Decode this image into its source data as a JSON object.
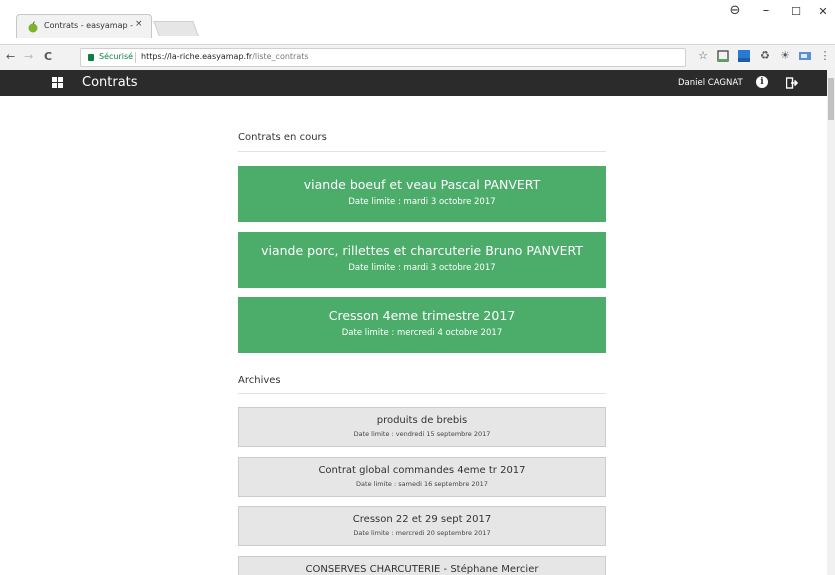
{
  "browser": {
    "tab_title": "Contrats - easyamap -",
    "tab_close": "×",
    "secure_label": "Sécurisé",
    "url_host": "https://la-riche.easyamap.fr",
    "url_path": "/liste_contrats",
    "window_controls": {
      "account": "⊖",
      "minimize": "–",
      "maximize": "☐",
      "close": "✕"
    },
    "nav": {
      "back": "←",
      "forward": "→",
      "reload": "C"
    },
    "toolbar_icons": [
      "star-icon",
      "extension-icon",
      "new-extension-icon",
      "recycle-icon",
      "extension-icon",
      "screenshot-icon",
      "menu-icon"
    ],
    "star": "☆",
    "menu": "⋮"
  },
  "header": {
    "title": "Contrats",
    "user": "Daniel CAGNAT",
    "info_glyph": "i",
    "logout_glyph": "⮐",
    "bg": "#2b2b2b"
  },
  "current": {
    "heading": "Contrats en cours",
    "accent": "#4cad6a",
    "items": [
      {
        "title": "viande boeuf et veau Pascal PANVERT",
        "date": "Date limite : mardi 3 octobre 2017"
      },
      {
        "title": "viande porc, rillettes et charcuterie Bruno PANVERT",
        "date": "Date limite : mardi 3 octobre 2017"
      },
      {
        "title": "Cresson 4eme trimestre 2017",
        "date": "Date limite : mercredi 4 octobre 2017"
      }
    ]
  },
  "archives": {
    "heading": "Archives",
    "items": [
      {
        "title": "produits de brebis",
        "date": "Date limite : vendredi 15 septembre 2017"
      },
      {
        "title": "Contrat global commandes 4eme tr 2017",
        "date": "Date limite : samedi 16 septembre 2017"
      },
      {
        "title": "Cresson 22 et 29 sept 2017",
        "date": "Date limite : mercredi 20 septembre 2017"
      },
      {
        "title": "CONSERVES CHARCUTERIE - Stéphane Mercier",
        "date": ""
      }
    ]
  }
}
